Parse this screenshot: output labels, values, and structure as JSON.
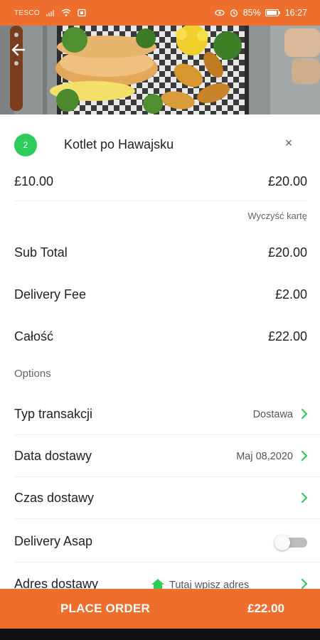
{
  "status_bar": {
    "carrier": "TESCO",
    "battery": "85%",
    "time": "16:27"
  },
  "header": {
    "back_icon": "arrow-left-icon",
    "hero_image": "food-photo"
  },
  "cart_item": {
    "quantity": "2",
    "name": "Kotlet po Hawajsku",
    "unit_price": "£10.00",
    "line_total": "£20.00"
  },
  "clear_cart_label": "Wyczyść kartę",
  "summary": {
    "subtotal_label": "Sub Total",
    "subtotal_value": "£20.00",
    "delivery_fee_label": "Delivery Fee",
    "delivery_fee_value": "£2.00",
    "total_label": "Całość",
    "total_value": "£22.00"
  },
  "options": {
    "title": "Options",
    "transaction_type": {
      "label": "Typ transakcji",
      "value": "Dostawa"
    },
    "delivery_date": {
      "label": "Data dostawy",
      "value": "Maj 08,2020"
    },
    "delivery_time": {
      "label": "Czas dostawy",
      "value": ""
    },
    "delivery_asap": {
      "label": "Delivery Asap",
      "enabled": false
    },
    "delivery_address": {
      "label": "Adres dostawy",
      "placeholder": "Tutaj wpisz adres"
    }
  },
  "place_order": {
    "label": "PLACE ORDER",
    "total": "£22.00"
  },
  "colors": {
    "accent": "#ee6f2d",
    "badge": "#2ecc5a",
    "chevron": "#2ecc5a"
  }
}
